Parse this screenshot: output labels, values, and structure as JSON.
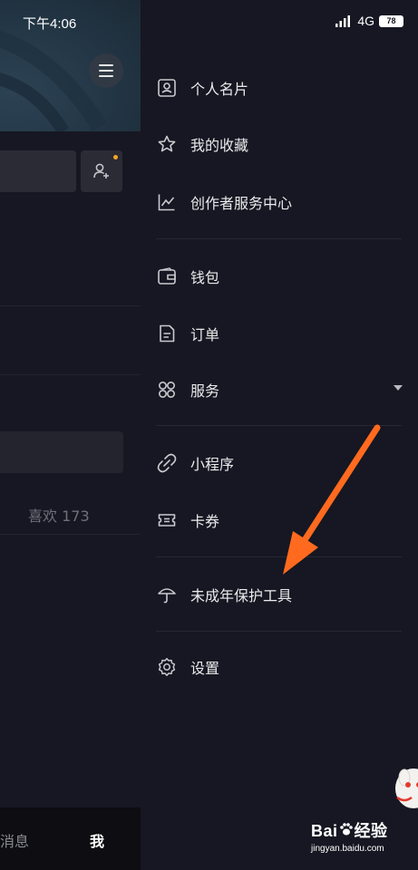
{
  "status_bar": {
    "time": "下午4:06",
    "network": "4G",
    "battery": "78"
  },
  "left_panel": {
    "likes_label": "喜欢 173",
    "tab_messages": "消息",
    "tab_me": "我"
  },
  "drawer": {
    "items": [
      {
        "label": "个人名片",
        "icon": "contact-card-icon"
      },
      {
        "label": "我的收藏",
        "icon": "star-icon"
      },
      {
        "label": "创作者服务中心",
        "icon": "chart-line-icon"
      },
      {
        "label": "钱包",
        "icon": "wallet-icon"
      },
      {
        "label": "订单",
        "icon": "order-document-icon"
      },
      {
        "label": "服务",
        "icon": "grid-services-icon"
      },
      {
        "label": "小程序",
        "icon": "mini-program-link-icon"
      },
      {
        "label": "卡券",
        "icon": "coupon-ticket-icon"
      },
      {
        "label": "未成年保护工具",
        "icon": "umbrella-icon"
      },
      {
        "label": "设置",
        "icon": "gear-icon"
      }
    ]
  },
  "watermark": {
    "brand_left": "Bai",
    "brand_right": "经验",
    "url": "jingyan.baidu.com"
  },
  "colors": {
    "background": "#161722",
    "text": "#eaeaec",
    "accent_arrow": "#ff6a1f",
    "notification_dot": "#f5a623"
  }
}
